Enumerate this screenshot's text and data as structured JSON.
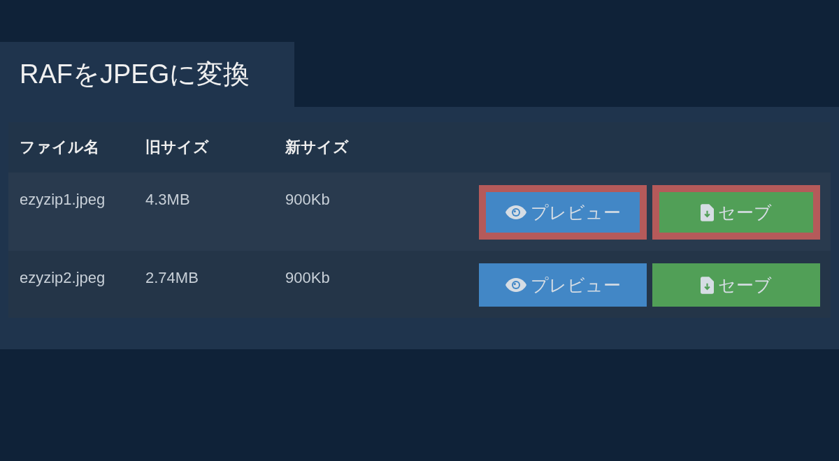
{
  "title": "RAFをJPEGに変換",
  "table": {
    "columns": [
      "ファイル名",
      "旧サイズ",
      "新サイズ"
    ],
    "rows": [
      {
        "name": "ezyzip1.jpeg",
        "old_size": "4.3MB",
        "new_size": "900Kb",
        "preview": "プレビュー",
        "save": "セーブ",
        "highlighted": true
      },
      {
        "name": "ezyzip2.jpeg",
        "old_size": "2.74MB",
        "new_size": "900Kb",
        "preview": "プレビュー",
        "save": "セーブ",
        "highlighted": false
      }
    ]
  }
}
